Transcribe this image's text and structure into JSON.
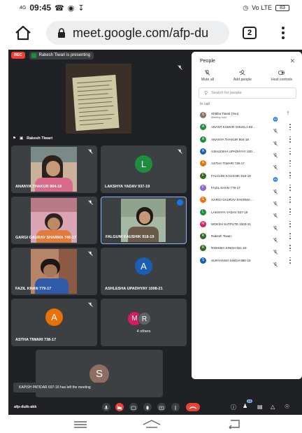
{
  "status_bar": {
    "time": "09:45",
    "network_left": "4G",
    "network_right": "Vo LTE",
    "battery": "83"
  },
  "browser": {
    "url": "meet.google.com/afp-du",
    "tab_count": "2"
  },
  "meet": {
    "rec_label": "REC",
    "presenting_text": "Rakesh Tiwari is presenting",
    "presenter_name": "Rakesh Tiwari",
    "tiles": [
      {
        "name": "ANANYA THAKUR 904-18"
      },
      {
        "name": "LAKSHYA YADAV 937-19",
        "initial": "L",
        "color": "#1e8e3e"
      },
      {
        "name": "GARGI GAURAV SHARMA 746-17"
      },
      {
        "name": "FALGUNI KAUSHIK 918-19"
      },
      {
        "name": "FAZIL KHAN 779-17"
      },
      {
        "name": "ASHLESHA UPADHYAY 1008-21",
        "initial": "A",
        "color": "#1a5fb4"
      },
      {
        "name": "ASTHA TIWARI 738-17",
        "initial": "A",
        "color": "#e8710a"
      },
      {
        "others_label": "4 others",
        "initial_a": "M",
        "initial_b": "R"
      },
      {
        "name": "You",
        "initial": "S"
      }
    ],
    "toast": "KAPISH PATIDAR 697-16 has left the meeting",
    "meeting_code": "afp-duik-akk",
    "participant_count": "15"
  },
  "people_panel": {
    "title": "People",
    "actions": {
      "mute_all": "Mute all",
      "add_people": "Add people",
      "host_controls": "Host controls"
    },
    "search_placeholder": "Search for people",
    "in_call_label": "In call",
    "participants": [
      {
        "initial": "S",
        "name": "Shikha Tiwari (You)",
        "sub": "Meeting host",
        "color": "#8d6e63"
      },
      {
        "initial": "A",
        "name": "ANANT KUMAR SHUKLA 82...",
        "color": "#1e8e3e"
      },
      {
        "initial": "A",
        "name": "ANANYA THAKUR 904-18",
        "color": "#1e8e3e"
      },
      {
        "initial": "A",
        "name": "ASHLESHA UPADHYAY 100...",
        "color": "#1a5fb4"
      },
      {
        "initial": "A",
        "name": "ASTHA TIWARI 738-17",
        "color": "#e8710a"
      },
      {
        "initial": "F",
        "name": "FALGUNI KAUSHIK 918-19",
        "color": "#33691e"
      },
      {
        "initial": "F",
        "name": "FAZIL KHAN 779-17",
        "color": "#8e6ac8"
      },
      {
        "initial": "G",
        "name": "GARGI GAURAV SHARMA ...",
        "color": "#e8710a"
      },
      {
        "initial": "L",
        "name": "LAKSHYA YADAV 937-19",
        "color": "#1e8e3e"
      },
      {
        "initial": "M",
        "name": "MOKSH SATPUTE 1003-21",
        "color": "#d81b60"
      },
      {
        "initial": "R",
        "name": "Rakesh Tiwari",
        "color": "#33691e"
      },
      {
        "initial": "R",
        "name": "RIDHIMA SINGH 921-19",
        "color": "#33691e"
      },
      {
        "initial": "S",
        "name": "SURYANSH SINGH 880-16",
        "color": "#1a5fb4"
      }
    ]
  }
}
